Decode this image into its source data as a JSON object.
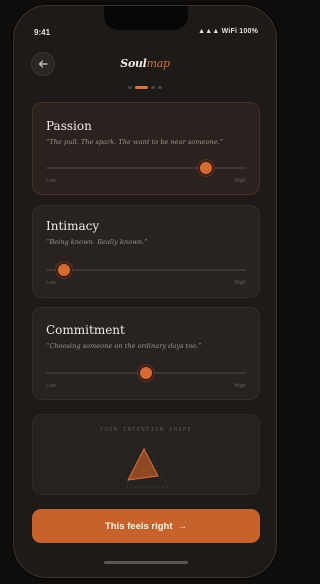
{
  "status": {
    "time": "9:41",
    "indicators": "▲▲▲ WiFi 100%"
  },
  "header": {
    "brand_part1": "Soul",
    "brand_part2": "map",
    "back_icon": "arrow-left-icon"
  },
  "progress": {
    "steps": 4,
    "current": 2
  },
  "sliders": [
    {
      "title": "Passion",
      "quote": "“The pull. The spark. The want to be near someone.”",
      "low": "Low",
      "high": "High",
      "value": 0.8
    },
    {
      "title": "Intimacy",
      "quote": "“Being known. Really known.”",
      "low": "Low",
      "high": "High",
      "value": 0.09
    },
    {
      "title": "Commitment",
      "quote": "“Choosing someone on the ordinary days too.”",
      "low": "Low",
      "high": "High",
      "value": 0.5
    }
  ],
  "shape": {
    "title": "YOUR INTENTION SHAPE"
  },
  "cta": {
    "label": "This feels right",
    "arrow": "→"
  },
  "colors": {
    "accent": "#d46b32",
    "background": "#1d1a18",
    "card": "#282320"
  }
}
